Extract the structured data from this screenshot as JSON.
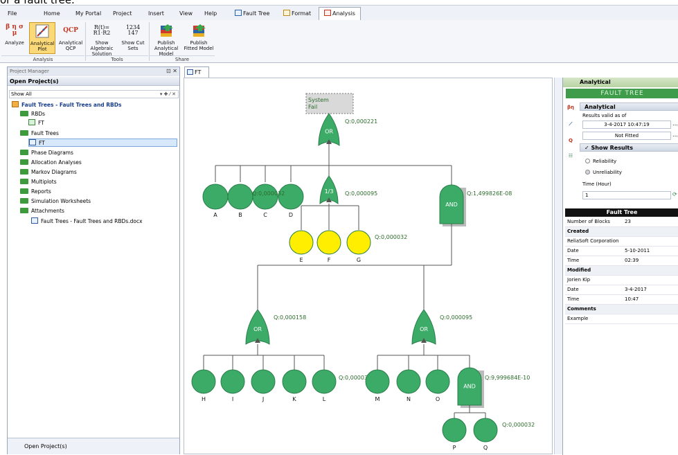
{
  "caption": "or a fault tree.",
  "menu": {
    "file": "File",
    "home": "Home",
    "portal": "My Portal",
    "project": "Project",
    "insert": "Insert",
    "view": "View",
    "help": "Help",
    "fault_tree": "Fault Tree",
    "format": "Format",
    "analysis": "Analysis"
  },
  "ribbon": {
    "analyze": "Analyze",
    "aplot": "Analytical Plot",
    "aqcp": "Analytical QCP",
    "show_alg": "Show Algebraic Solution",
    "show_cut": "Show Cut Sets",
    "pub_am": "Publish Analytical Model",
    "pub_fm": "Publish Fitted Model",
    "group_analysis": "Analysis",
    "group_tools": "Tools",
    "group_share": "Share",
    "alg_icon": "R(t)= R1·R2",
    "cut_icon": "1234 147",
    "beta_icon": "β η σ μ",
    "qcp_icon": "QCP"
  },
  "left": {
    "pm_title": "Project Manager",
    "open_projects": "Open Project(s)",
    "show_all": "Show All",
    "tree": [
      {
        "label": "Fault Trees - Fault Trees and RBDs",
        "icon": "project-icon"
      },
      {
        "label": "RBDs",
        "icon": "folder-icon"
      },
      {
        "label": "FT",
        "icon": "rbd-icon"
      },
      {
        "label": "Fault Trees",
        "icon": "folder-icon"
      },
      {
        "label": "FT",
        "icon": "fault-tree-icon"
      },
      {
        "label": "Phase Diagrams",
        "icon": "folder-icon"
      },
      {
        "label": "Allocation Analyses",
        "icon": "folder-icon"
      },
      {
        "label": "Markov Diagrams",
        "icon": "folder-icon"
      },
      {
        "label": "Multiplots",
        "icon": "folder-icon"
      },
      {
        "label": "Reports",
        "icon": "folder-icon"
      },
      {
        "label": "Simulation Worksheets",
        "icon": "folder-icon"
      },
      {
        "label": "Attachments",
        "icon": "folder-icon"
      },
      {
        "label": "Fault Trees - Fault Trees and RBDs.docx",
        "icon": "document-icon"
      }
    ],
    "bottom_tab": "Open Project(s)"
  },
  "doc_tab": "FT",
  "diagram": {
    "top_event": "System Fail",
    "top_q": "Q:0,000221",
    "or_label": "OR",
    "and_label": "AND",
    "vote_label": "1/3",
    "q_a": "Q:0,000032",
    "q_vote": "Q:0,000095",
    "q_and1": "Q:1,499826E-08",
    "q_or_left": "Q:0,000158",
    "q_or_right": "Q:0,000095",
    "q_and2": "Q:9,999684E-10",
    "q_efg": "Q:0,000032",
    "q_m": "Q:0,000032",
    "q_pq": "Q:0,000032",
    "events": {
      "a": "A",
      "b": "B",
      "c": "C",
      "d": "D",
      "e": "E",
      "f": "F",
      "g": "G",
      "h": "H",
      "i": "I",
      "j": "J",
      "k": "K",
      "l": "L",
      "m": "M",
      "n": "N",
      "o": "O",
      "p": "P",
      "q": "Q"
    }
  },
  "right": {
    "header": "Analytical",
    "banner": "FAULT TREE",
    "section": "Analytical",
    "valid_label": "Results valid as of",
    "valid_value": "3-4-2017 10:47:19",
    "fitted": "Not Fitted",
    "show_results": "Show Results",
    "reliability": "Reliability",
    "unreliability": "Unreliability",
    "time_label": "Time (Hour)",
    "time_value": "1",
    "table_title": "Fault Tree",
    "rows": [
      {
        "k": "Number of Blocks",
        "v": "23"
      },
      {
        "k": "Created",
        "v": ""
      },
      {
        "k": "ReliaSoft Corporation",
        "v": ""
      },
      {
        "k": "Date",
        "v": "5-10-2011"
      },
      {
        "k": "Time",
        "v": "02:39"
      },
      {
        "k": "Modified",
        "v": ""
      },
      {
        "k": "Jorien Kip",
        "v": ""
      },
      {
        "k": "Date",
        "v": "3-4-2017"
      },
      {
        "k": "Time",
        "v": "10:47"
      },
      {
        "k": "Comments",
        "v": ""
      },
      {
        "k": "Example",
        "v": ""
      }
    ]
  },
  "colors": {
    "gate": "#3dab68",
    "gate_stroke": "#2a7d49",
    "basic": "#3dab68",
    "highlight": "#ffee00",
    "link": "#555555",
    "q_text": "#2b6b2b"
  }
}
